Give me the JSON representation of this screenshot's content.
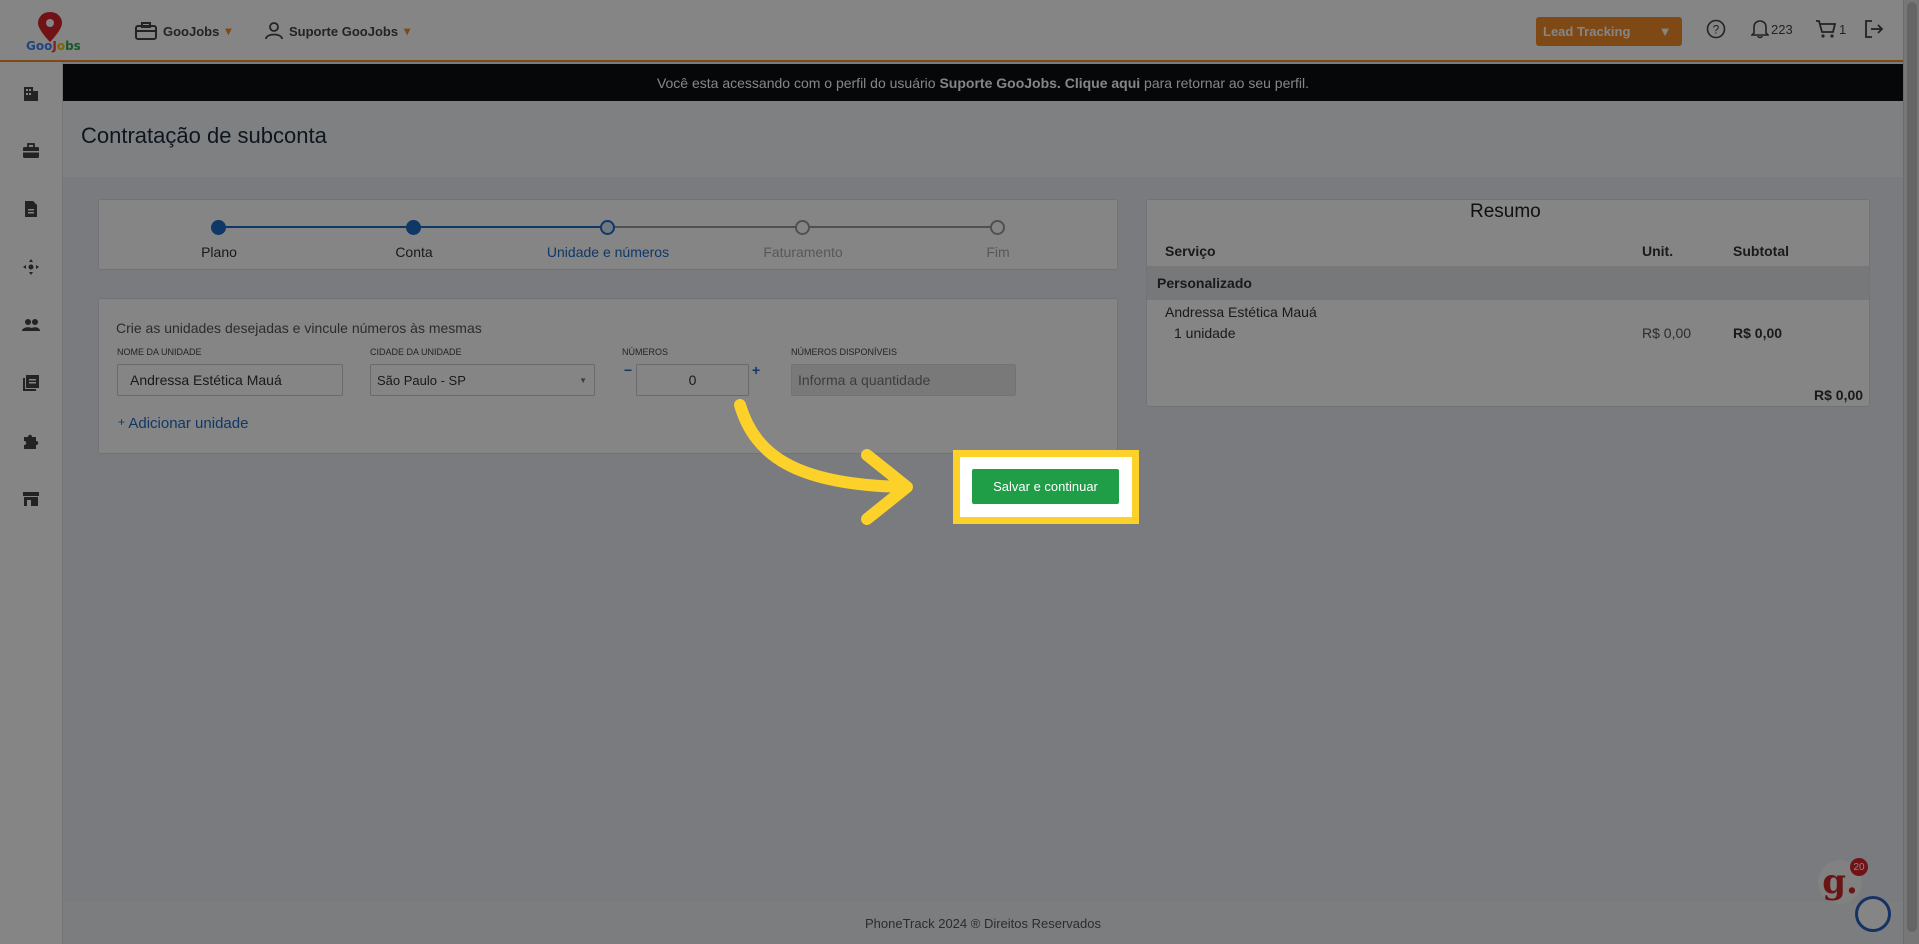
{
  "header": {
    "logo_text": {
      "g1": "Goo",
      "g2": "J",
      "g3": "o",
      "g4": "bs"
    },
    "nav": [
      {
        "label": "GooJobs"
      },
      {
        "label": "Suporte GooJobs"
      }
    ],
    "lead_button": "Lead Tracking",
    "notifications_count": "223",
    "cart_count": "1"
  },
  "banner": {
    "prefix": "Você esta acessando com o perfil do usuário",
    "user": "Suporte GooJobs.",
    "link": "Clique aqui",
    "suffix": "para retornar ao seu perfil."
  },
  "page": {
    "title": "Contratação de subconta"
  },
  "stepper": {
    "steps": [
      {
        "label": "Plano",
        "state": "done"
      },
      {
        "label": "Conta",
        "state": "done"
      },
      {
        "label": "Unidade e números",
        "state": "current"
      },
      {
        "label": "Faturamento",
        "state": "pending"
      },
      {
        "label": "Fim",
        "state": "pending"
      }
    ],
    "colors": {
      "done": "#1e6bc4",
      "pending": "#999999"
    }
  },
  "form": {
    "hint": "Crie as unidades desejadas e vincule números às mesmas",
    "unit_name_label": "Nome da unidade",
    "unit_name_value": "Andressa Estética Mauá",
    "city_label": "Cidade da unidade",
    "city_value": "São Paulo - SP",
    "numbers_label": "Números",
    "numbers_value": "0",
    "minus": "−",
    "plus": "+",
    "available_label": "Números disponíveis",
    "available_placeholder": "Informa a quantidade",
    "add_unit": "Adicionar unidade",
    "add_unit_plus": "+"
  },
  "summary": {
    "title": "Resumo",
    "headers": {
      "service": "Serviço",
      "unit": "Unit.",
      "subtotal": "Subtotal"
    },
    "group": "Personalizado",
    "item_name": "Andressa Estética Mauá",
    "item_qty": "1 unidade",
    "item_unit": "R$ 0,00",
    "item_subtotal": "R$ 0,00",
    "total": "R$ 0,00"
  },
  "actions": {
    "save": "Salvar e continuar"
  },
  "footer": {
    "text": "PhoneTrack 2024 ® Direitos Reservados"
  },
  "chat": {
    "badge": "20"
  },
  "theme": {
    "accent": "#f28c28",
    "primary": "#1e6bc4",
    "success": "#1f9d47",
    "highlight": "#fcd12a"
  }
}
